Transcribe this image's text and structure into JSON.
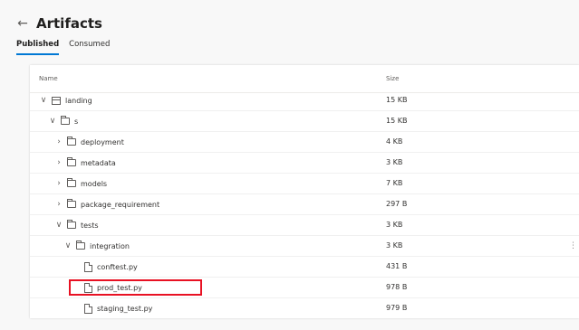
{
  "header": {
    "back_icon": "arrow-left-icon",
    "back_glyph": "←",
    "title": "Artifacts"
  },
  "tabs": [
    {
      "label": "Published",
      "active": true
    },
    {
      "label": "Consumed",
      "active": false
    }
  ],
  "table": {
    "columns": {
      "name": "Name",
      "size": "Size"
    },
    "more_glyph": "⋮",
    "rows": [
      {
        "name": "landing",
        "size": "15 KB",
        "icon": "package-icon",
        "expanded": true,
        "level": 0,
        "chevron": "∨"
      },
      {
        "name": "s",
        "size": "15 KB",
        "icon": "folder-icon",
        "expanded": true,
        "level": 1,
        "chevron": "∨"
      },
      {
        "name": "deployment",
        "size": "4 KB",
        "icon": "folder-icon",
        "expanded": false,
        "level": 2,
        "chevron": "›"
      },
      {
        "name": "metadata",
        "size": "3 KB",
        "icon": "folder-icon",
        "expanded": false,
        "level": 2,
        "chevron": "›"
      },
      {
        "name": "models",
        "size": "7 KB",
        "icon": "folder-icon",
        "expanded": false,
        "level": 2,
        "chevron": "›"
      },
      {
        "name": "package_requirement",
        "size": "297 B",
        "icon": "folder-icon",
        "expanded": false,
        "level": 2,
        "chevron": "›"
      },
      {
        "name": "tests",
        "size": "3 KB",
        "icon": "folder-icon",
        "expanded": true,
        "level": 2,
        "chevron": "∨"
      },
      {
        "name": "integration",
        "size": "3 KB",
        "icon": "folder-icon",
        "expanded": true,
        "level": 3,
        "chevron": "∨"
      },
      {
        "name": "conftest.py",
        "size": "431 B",
        "icon": "file-icon",
        "level": 4
      },
      {
        "name": "prod_test.py",
        "size": "978 B",
        "icon": "file-icon",
        "level": 4,
        "highlighted": true
      },
      {
        "name": "staging_test.py",
        "size": "979 B",
        "icon": "file-icon",
        "level": 4
      }
    ]
  },
  "colors": {
    "accent": "#0078d4",
    "highlight_border": "#e81123"
  }
}
